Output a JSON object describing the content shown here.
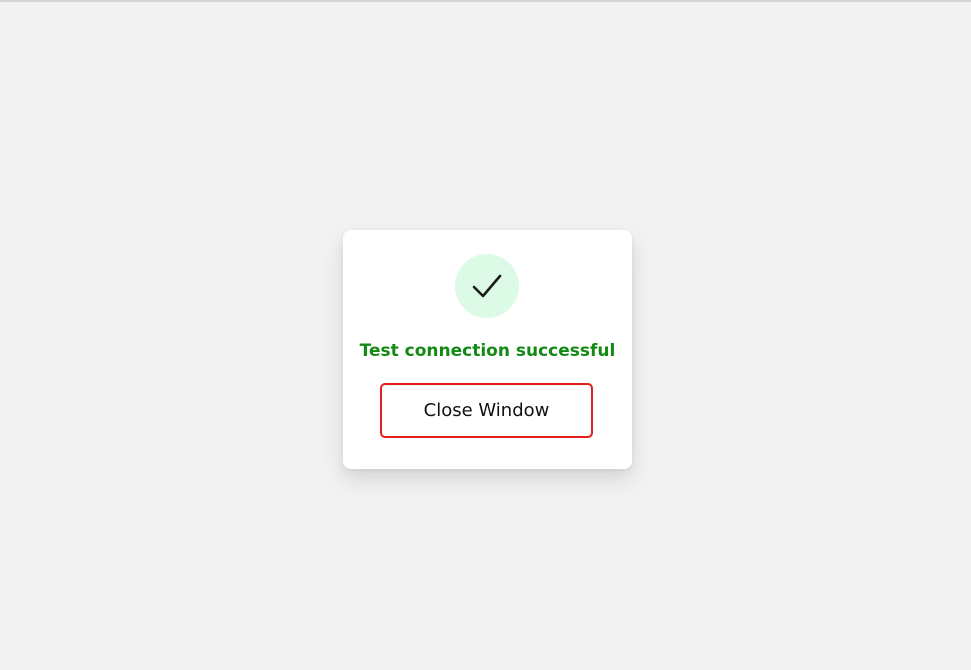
{
  "dialog": {
    "icon": "checkmark-icon",
    "message": "Test connection successful",
    "close_label": "Close Window"
  },
  "colors": {
    "background": "#f2f2f2",
    "card": "#ffffff",
    "success_text": "#138a13",
    "icon_bg": "#dcfae6",
    "button_border": "#e41e1e"
  }
}
